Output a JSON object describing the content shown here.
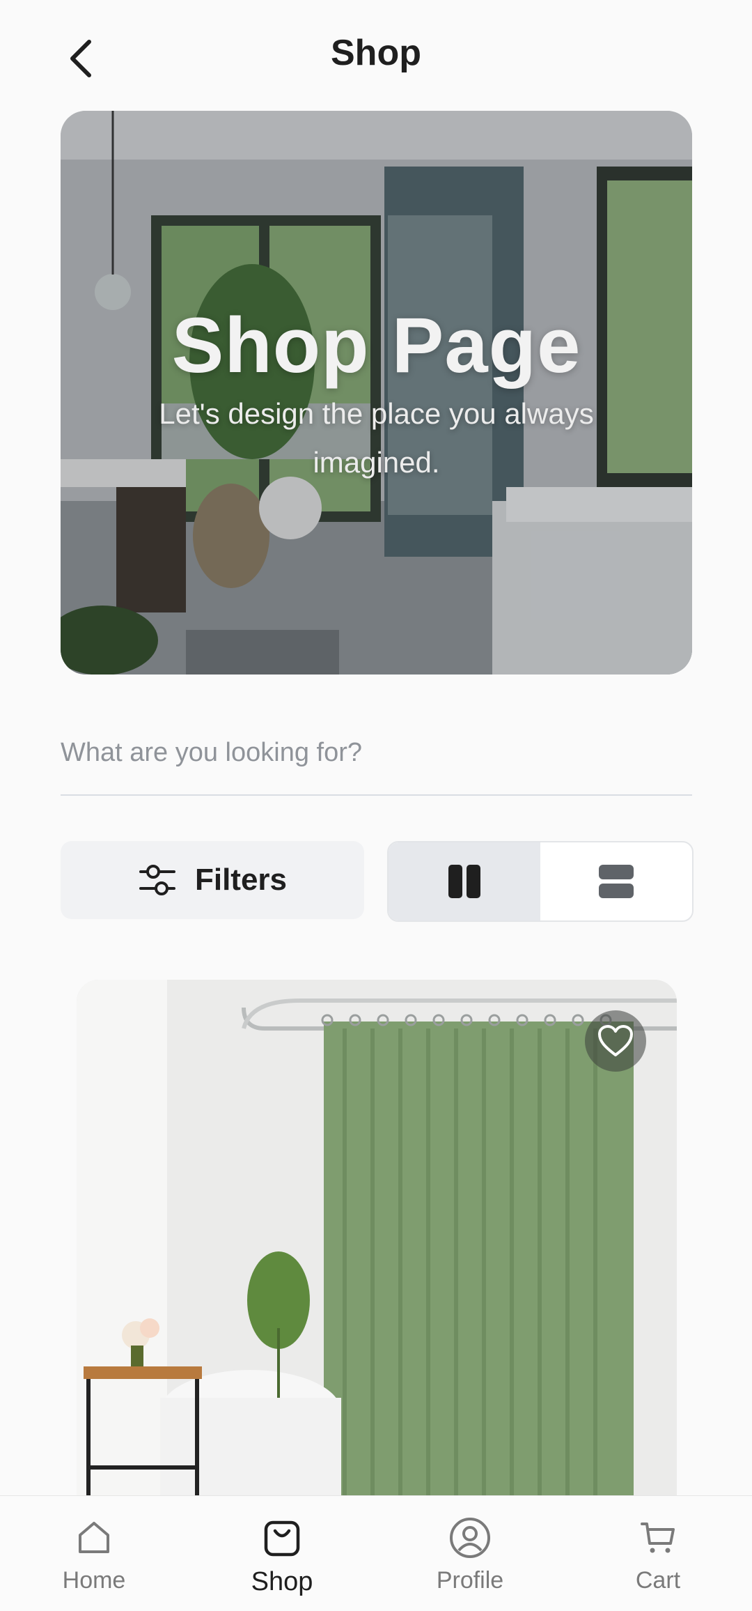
{
  "header": {
    "title": "Shop",
    "back_icon": "chevron-left-icon"
  },
  "hero": {
    "title": "Shop Page",
    "subtitle": "Let's design the place you always imagined."
  },
  "search": {
    "placeholder": "What are you looking for?",
    "value": ""
  },
  "toolbar": {
    "filters_label": "Filters",
    "filters_icon": "sliders-icon",
    "view_modes": [
      {
        "name": "grid-two-column",
        "icon": "two-columns-icon",
        "active": true
      },
      {
        "name": "list-rows",
        "icon": "two-rows-icon",
        "active": false
      }
    ]
  },
  "product": {
    "favorite_icon": "heart-icon"
  },
  "bottom_nav": {
    "items": [
      {
        "label": "Home",
        "icon": "home-icon",
        "active": false
      },
      {
        "label": "Shop",
        "icon": "shopping-bag-icon",
        "active": true
      },
      {
        "label": "Profile",
        "icon": "user-circle-icon",
        "active": false
      },
      {
        "label": "Cart",
        "icon": "cart-icon",
        "active": false
      }
    ]
  },
  "colors": {
    "accent_dark": "#1f1f1f",
    "muted": "#7a7a7a",
    "surface": "#f1f2f4",
    "curtain": "#7f9d6f"
  }
}
